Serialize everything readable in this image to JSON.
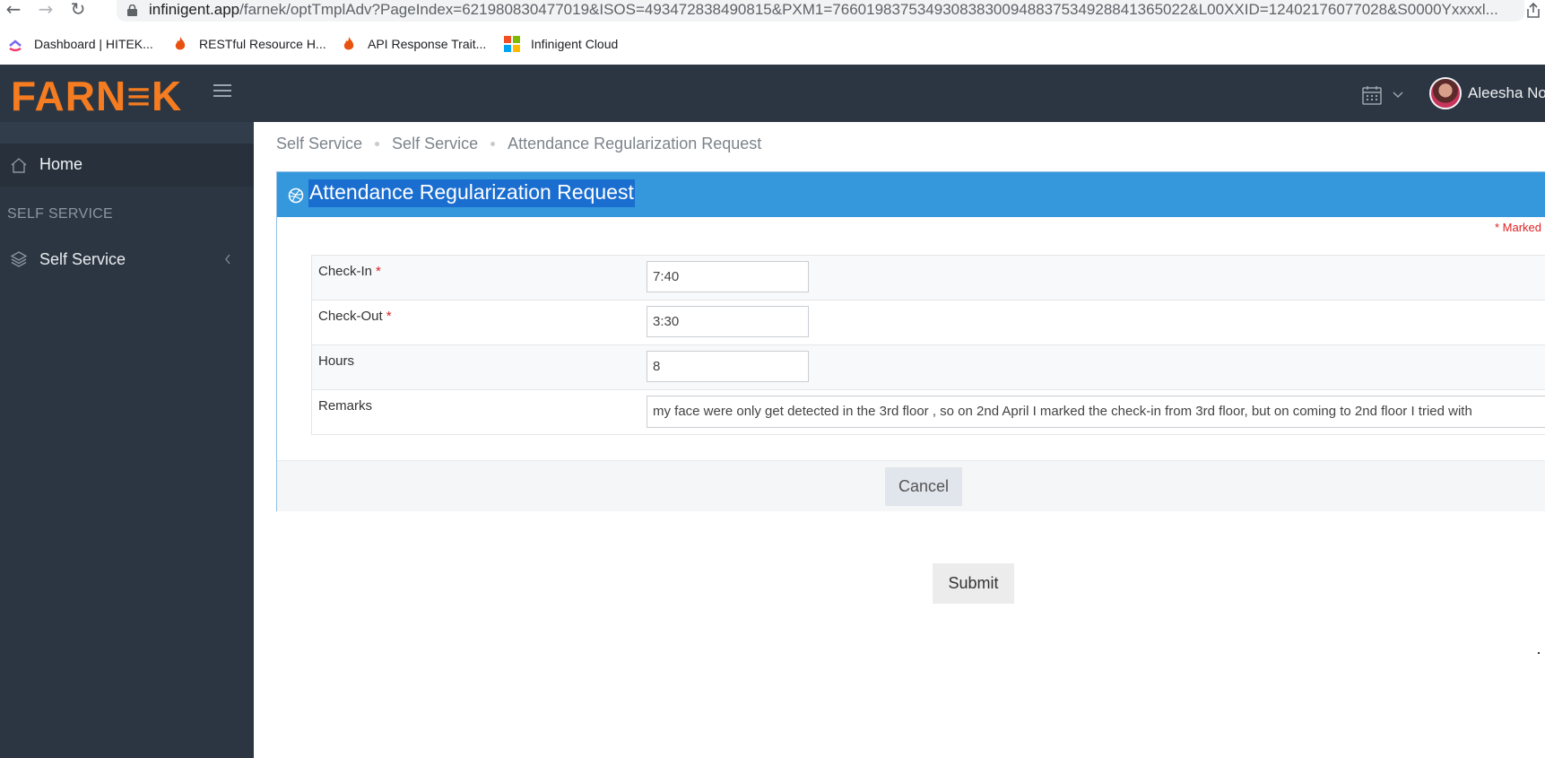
{
  "browser": {
    "url_domain": "infinigent.app",
    "url_path": "/farnek/optTmplAdv?PageIndex=621980830477019&ISOS=493472838490815&PXM1=7660198375349308383009488375349288413650​22&L00XXID=12402176077028&S0000Yxxxxl...",
    "bookmarks": [
      {
        "label": "Dashboard | HITEK...",
        "icon": "clickup-icon"
      },
      {
        "label": "RESTful Resource H...",
        "icon": "flame-icon"
      },
      {
        "label": "API Response Trait...",
        "icon": "flame-icon"
      },
      {
        "label": "Infinigent Cloud",
        "icon": "microsoft-icon"
      }
    ]
  },
  "header": {
    "logo": "FARN≡K",
    "user_name": "Aleesha No"
  },
  "sidebar": {
    "home_label": "Home",
    "section_label": "SELF SERVICE",
    "self_service_label": "Self Service"
  },
  "breadcrumb": [
    "Self Service",
    "Self Service",
    "Attendance Regularization Request"
  ],
  "form": {
    "title": "Attendance Regularization Request",
    "marked_note": "*  Marked",
    "rows": [
      {
        "label": "Check-In",
        "required": "*",
        "value": "7:40"
      },
      {
        "label": "Check-Out",
        "required": "*",
        "value": "3:30"
      },
      {
        "label": "Hours",
        "required": "",
        "value": "8"
      },
      {
        "label": "Remarks",
        "required": "",
        "value": "my face were only get detected in the 3rd floor , so on 2nd April I marked the check-in from 3rd floor, but on coming to 2nd floor I tried with"
      }
    ],
    "cancel_label": "Cancel"
  },
  "submit_label": "Submit",
  "colors": {
    "header_bg": "#2c3642",
    "logo_orange": "#f57c20",
    "panel_blue": "#3598dc",
    "required_red": "#e02222"
  }
}
